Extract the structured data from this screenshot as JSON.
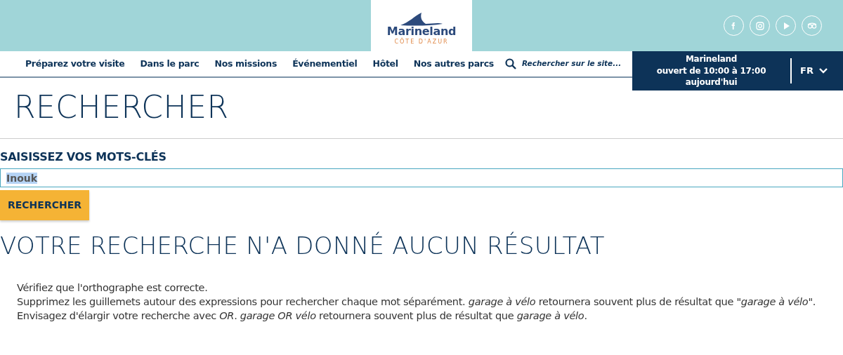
{
  "logo": {
    "name": "Marineland",
    "tagline": "CÔTE D'AZUR"
  },
  "social": [
    {
      "kind": "facebook"
    },
    {
      "kind": "instagram"
    },
    {
      "kind": "youtube"
    },
    {
      "kind": "tripadvisor"
    }
  ],
  "nav": [
    "Préparez votre visite",
    "Dans le parc",
    "Nos missions",
    "Événementiel",
    "Hôtel",
    "Nos autres parcs"
  ],
  "site_search": {
    "placeholder": "Rechercher sur le site..."
  },
  "hours": [
    "Marineland",
    "ouvert de 10:00 à 17:00",
    "aujourd'hui"
  ],
  "language": "FR",
  "page_title": "RECHERCHER",
  "search_form": {
    "label": "SAISISSEZ VOS MOTS-CLÉS",
    "value": "Inouk",
    "value_selected": true,
    "button": "RECHERCHER"
  },
  "result_heading": "VOTRE RECHERCHE N'A DONNÉ AUCUN RÉSULTAT",
  "tips": [
    "Vérifiez que l'orthographe est correcte.",
    "Supprimez les guillemets autour des expressions pour rechercher chaque mot séparément. *garage à vélo* retournera souvent plus de résultat que *\"garage à vélo\"*.",
    "Envisagez d'élargir votre recherche avec *OR*. *garage OR vélo* retournera souvent plus de résultat que *garage à vélo*."
  ]
}
